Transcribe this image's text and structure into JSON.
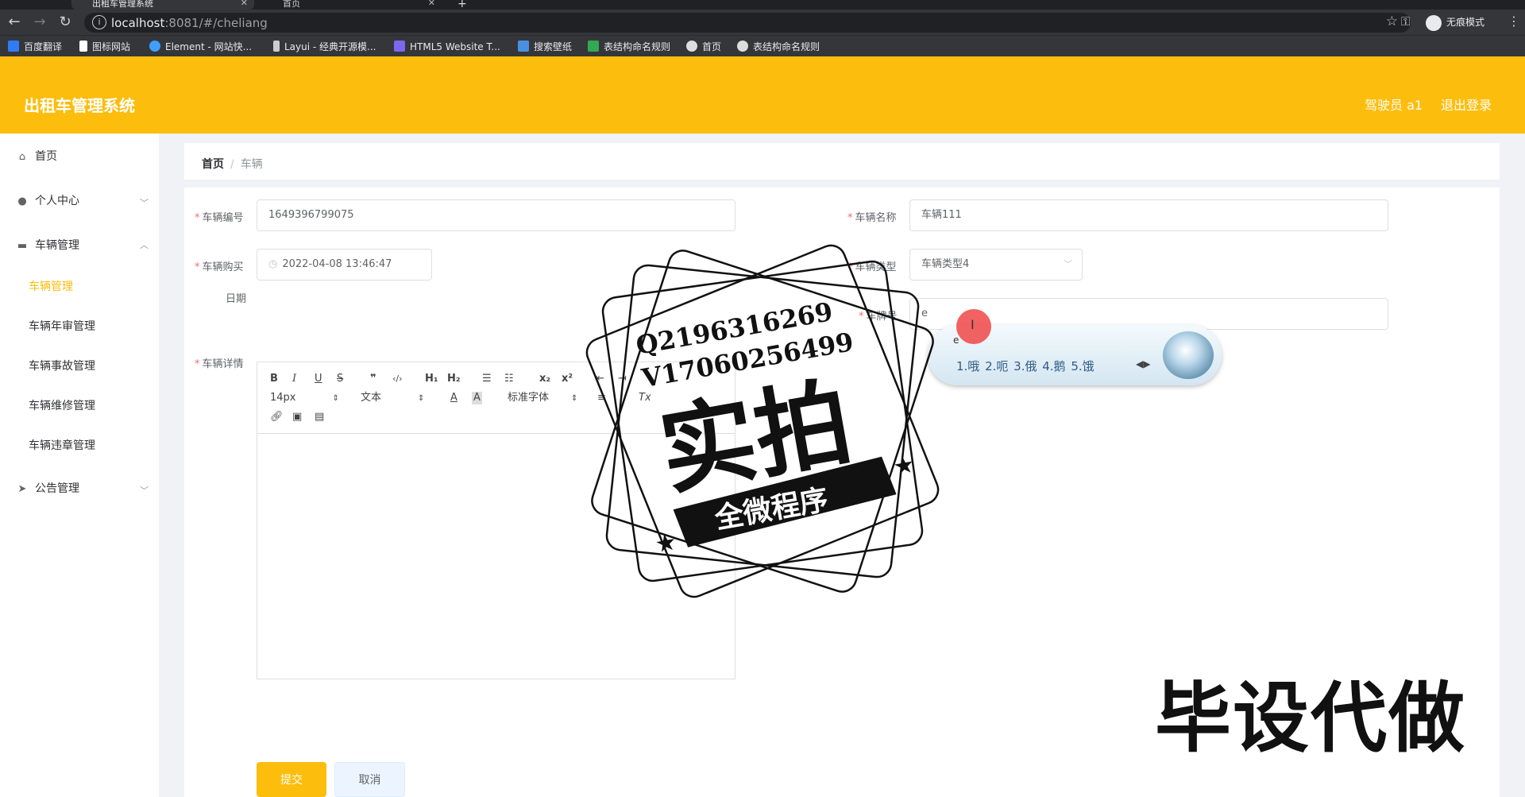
{
  "browser": {
    "tabs": [
      {
        "title": "出租车管理系统",
        "active": true
      },
      {
        "title": "首页",
        "active": false
      }
    ],
    "new_tab": "+",
    "url_host": "localhost",
    "url_rest": ":8081/#/cheliang",
    "incognito": "无痕模式",
    "bookmarks": [
      {
        "label": "百度翻译",
        "color": "#2f7cf6"
      },
      {
        "label": "图标网站",
        "color": "#ffffff"
      },
      {
        "label": "Element - 网站快...",
        "color": "#409eff"
      },
      {
        "label": "Layui - 经典开源模...",
        "color": "#cccccc"
      },
      {
        "label": "HTML5 Website T...",
        "color": "#7b68ee"
      },
      {
        "label": "搜索壁纸",
        "color": "#4a90e2"
      },
      {
        "label": "表结构命名规则",
        "color": "#34a853"
      },
      {
        "label": "首页",
        "color": "#dddddd"
      },
      {
        "label": "表结构命名规则",
        "color": "#dddddd"
      }
    ]
  },
  "header": {
    "title": "出租车管理系统",
    "user": "驾驶员 a1",
    "logout": "退出登录"
  },
  "sidebar": {
    "home": "首页",
    "personal": "个人中心",
    "vehicle_mgmt": "车辆管理",
    "sub_items": [
      "车辆管理",
      "车辆年审管理",
      "车辆事故管理",
      "车辆维修管理",
      "车辆违章管理"
    ],
    "notice": "公告管理"
  },
  "breadcrumb": {
    "home": "首页",
    "separator": "/",
    "current": "车辆"
  },
  "form": {
    "vehicle_no_label": "车辆编号",
    "vehicle_no": "1649396799075",
    "vehicle_name_label": "车辆名称",
    "vehicle_name": "车辆111",
    "purchase_date_label": "车辆购买",
    "purchase_date_label2": "日期",
    "purchase_date": "2022-04-08 13:46:47",
    "vehicle_type_label": "车辆类型",
    "vehicle_type": "车辆类型4",
    "plate_label": "车牌号",
    "plate_value": "e",
    "detail_label": "车辆详情",
    "submit": "提交",
    "cancel": "取消"
  },
  "editor_toolbar": {
    "bold": "B",
    "italic": "I",
    "underline": "U",
    "strike": "S",
    "quote": "❞",
    "code": "‹/›",
    "h1": "H₁",
    "h2": "H₂",
    "ordered": "☰",
    "bullet": "☷",
    "sub": "x₂",
    "sup": "x²",
    "indent_out": "⇤",
    "indent_in": "⇥",
    "size": "14px",
    "paragraph": "文本",
    "font": "标准字体",
    "color": "A",
    "background": "A",
    "align": "≡",
    "clean": "Tx"
  },
  "ime": {
    "composition": "e",
    "candidates": "1.哦  2.呃  3.俄  4.鹅  5.饿",
    "arrows": "◀▶"
  },
  "watermark": {
    "contact_q": "Q2196316269",
    "contact_v": "V17060256499",
    "big": "实拍",
    "ribbon": "全微程序",
    "corner": "毕设代做"
  },
  "colors": {
    "accent": "#fdbd0c",
    "required": "#f56c6c",
    "chrome": "#35363a"
  }
}
